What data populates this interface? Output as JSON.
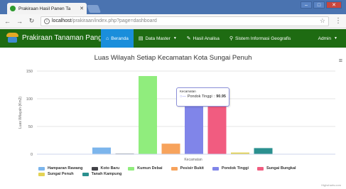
{
  "browser": {
    "tab_title": "Prakiraan Hasil Panen Ta",
    "url_host": "localhost",
    "url_path": "/prakiraan/index.php?page=dashboard"
  },
  "navbar": {
    "brand": "Prakiraan Tanaman Pangan",
    "items": [
      {
        "label": "Beranda",
        "icon": "home-icon",
        "active": true
      },
      {
        "label": "Data Master",
        "icon": "document-icon",
        "dropdown": true
      },
      {
        "label": "Hasil Analisa",
        "icon": "pencil-icon"
      },
      {
        "label": "Sistem Informasi Geografis",
        "icon": "map-marker-icon"
      }
    ],
    "admin": "Admin"
  },
  "tooltip": {
    "header": "Kecamatan",
    "series": "Pondok Tinggi",
    "value": "90.95"
  },
  "credits": "Highcharts.com",
  "chart_data": {
    "type": "bar",
    "title": "Luas Wilayah Setiap Kecamatan Kota Sungai Penuh",
    "xlabel": "Kecamatan",
    "ylabel": "Luas Wilayah (Km2)",
    "ylim": [
      0,
      150
    ],
    "yticks": [
      0,
      50,
      100,
      150
    ],
    "grid": true,
    "legend_position": "bottom",
    "series": [
      {
        "name": "Hamparan Rawang",
        "value": 12,
        "color": "#7cb5ec"
      },
      {
        "name": "Koto Baru",
        "value": 1,
        "color": "#434348"
      },
      {
        "name": "Kumun Debai",
        "value": 141,
        "color": "#90ed7d"
      },
      {
        "name": "Pesisir Bukit",
        "value": 19,
        "color": "#f7a35c"
      },
      {
        "name": "Pondok Tinggi",
        "value": 90.95,
        "color": "#8085e9"
      },
      {
        "name": "Sungai Bungkal",
        "value": 108,
        "color": "#f15c80"
      },
      {
        "name": "Sungai Penuh",
        "value": 3,
        "color": "#e4d354"
      },
      {
        "name": "Tanah Kampung",
        "value": 11,
        "color": "#2b908f"
      }
    ]
  }
}
